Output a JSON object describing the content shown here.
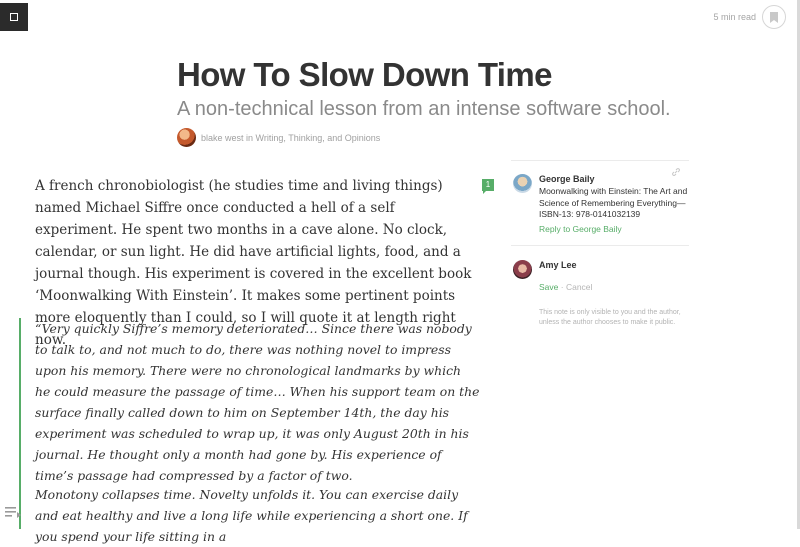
{
  "header": {
    "read_time": "5 min read"
  },
  "article": {
    "title": "How To Slow Down Time",
    "subtitle": "A non-technical lesson from an intense software school.",
    "byline": "blake west in Writing, Thinking, and Opinions",
    "paragraph_1": "A french chronobiologist (he studies time and living things) named Michael Siffre once conducted a hell of a self experiment. He spent two months in a cave alone. No clock, calendar, or sun light. He did have artificial lights, food, and a journal though. His experiment is covered in the excellent book ‘Moonwalking With Einstein’. It makes some pertinent points more eloquently than I could, so I will quote it at length right now.",
    "note_count": "1",
    "quote_1": "“Very quickly Siffre’s memory deteriorated… Since there was nobody to talk to, and not much to do, there was nothing novel to impress upon his memory. There were no chronological landmarks by which he could measure the passage of time… When his support team on the surface finally called down to him on September 14th, the day his experiment was scheduled to wrap up, it was only August 20th in his journal. He thought only a month had gone by. His experience of time’s passage had compressed by a factor of two.",
    "quote_2": "Monotony collapses time. Novelty unfolds it. You can exercise daily and eat healthy and live a long life while experiencing a short one. If you spend your life sitting in a"
  },
  "notes": {
    "note_1": {
      "author": "George Baily",
      "text": "Moonwalking with Einstein: The Art and Science of Remembering Everything—ISBN-13: 978-0141032139",
      "reply": "Reply to George Baily"
    },
    "note_2": {
      "author": "Amy Lee",
      "save": "Save",
      "separator": "·",
      "cancel": "Cancel",
      "privacy": "This note is only visible to you and the author, unless the author chooses to make it public."
    }
  },
  "icons": {
    "logo": "square-logo-icon",
    "bookmark": "bookmark-icon",
    "link": "link-icon",
    "toc": "table-of-contents-icon"
  },
  "colors": {
    "accent_green": "#57ad68",
    "logo_bg": "#2b2b2b",
    "text": "#333333",
    "muted": "#a5a5a5"
  }
}
